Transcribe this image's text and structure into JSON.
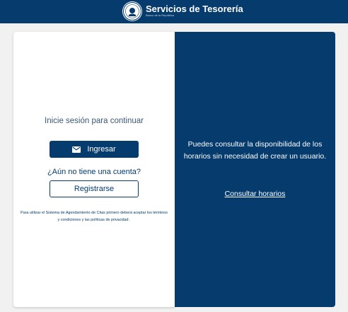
{
  "header": {
    "seal_icon": "seal-icon",
    "title": "Servicios de Tesorería",
    "subtitle": "Banco de la República"
  },
  "login": {
    "prompt": "Inicie sesión para continuar",
    "login_button_label": "Ingresar",
    "login_button_icon": "mail-icon",
    "no_account_text": "¿Aún no tiene una cuenta?",
    "register_button_label": "Registrarse",
    "terms_text": "Para utilizar el Sistema de Agendamiento de Citas primero deberá aceptar los términos y condiciones y las políticas de privacidad ."
  },
  "info": {
    "text": "Puedes consultar la disponibilidad de los horarios sin necesidad de crear un usuario.",
    "link_label": "Consultar horarios"
  },
  "colors": {
    "primary": "#063b6d",
    "background": "#f1f1f1",
    "card": "#ffffff"
  }
}
